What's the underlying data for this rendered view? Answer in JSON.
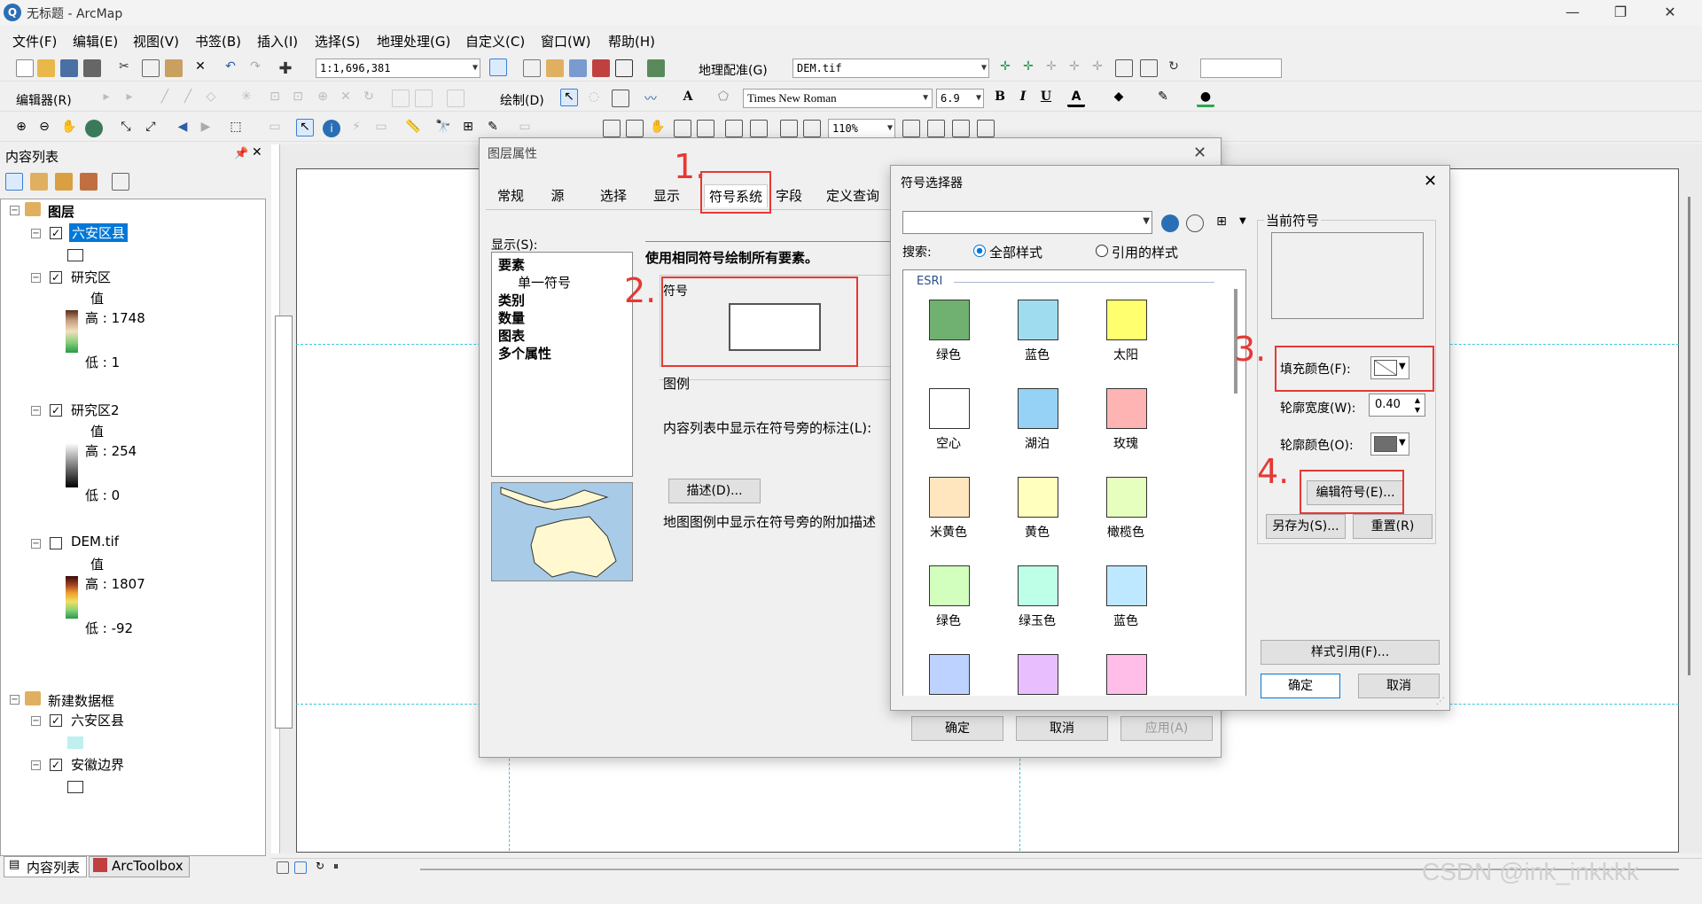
{
  "window": {
    "title": "无标题 - ArcMap",
    "icon": "arcmap-icon"
  },
  "menu": [
    "文件(F)",
    "编辑(E)",
    "视图(V)",
    "书签(B)",
    "插入(I)",
    "选择(S)",
    "地理处理(G)",
    "自定义(C)",
    "窗口(W)",
    "帮助(H)"
  ],
  "toolbar": {
    "scale": "1:1,696,381",
    "georef_label": "地理配准(G)",
    "georef_layer": "DEM.tif",
    "editor_label": "编辑器(R)",
    "draw_label": "绘制(D)",
    "font_name": "Times New Roman",
    "font_size": "6.9",
    "bold": "B",
    "italic": "I",
    "underline": "U",
    "zoom": "110%"
  },
  "toc": {
    "title": "内容列表",
    "root": "图层",
    "layers": [
      {
        "name": "六安区县",
        "checked": true,
        "selected": true
      },
      {
        "name": "研究区",
        "checked": true,
        "value_label": "值",
        "high": "高 : 1748",
        "low": "低 : 1"
      },
      {
        "name": "研究区2",
        "checked": true,
        "value_label": "值",
        "high": "高 : 254",
        "low": "低 : 0"
      },
      {
        "name": "DEM.tif",
        "checked": false,
        "value_label": "值",
        "high": "高 : 1807",
        "low": "低 : -92"
      }
    ],
    "frame2": "新建数据框",
    "frame2_layers": [
      {
        "name": "六安区县",
        "checked": true
      },
      {
        "name": "安徽边界",
        "checked": true
      }
    ],
    "bottom_tabs": [
      "内容列表",
      "ArcToolbox"
    ]
  },
  "layer_props": {
    "title": "图层属性",
    "tabs": [
      "常规",
      "源",
      "选择",
      "显示",
      "符号系统",
      "字段",
      "定义查询"
    ],
    "show_label": "显示(S):",
    "show_items": [
      "要素",
      "单一符号",
      "类别",
      "数量",
      "图表",
      "多个属性"
    ],
    "heading": "使用相同符号绘制所有要素。",
    "symbol_group": "符号",
    "legend_group": "图例",
    "legend_text": "内容列表中显示在符号旁的标注(L):",
    "describe_btn": "描述(D)...",
    "desc_text": "地图图例中显示在符号旁的附加描述",
    "ok": "确定",
    "cancel": "取消",
    "apply": "应用(A)"
  },
  "symbol_selector": {
    "title": "符号选择器",
    "search_label": "搜索:",
    "radio_all": "全部样式",
    "radio_ref": "引用的样式",
    "group": "ESRI",
    "symbols": [
      {
        "label": "绿色",
        "color": "#70b070"
      },
      {
        "label": "蓝色",
        "color": "#a0dcf0"
      },
      {
        "label": "太阳",
        "color": "#ffff70"
      },
      {
        "label": "空心",
        "color": "#ffffff"
      },
      {
        "label": "湖泊",
        "color": "#96d2f5"
      },
      {
        "label": "玫瑰",
        "color": "#ffb4b4"
      },
      {
        "label": "米黄色",
        "color": "#ffe6be"
      },
      {
        "label": "黄色",
        "color": "#ffffbe"
      },
      {
        "label": "橄榄色",
        "color": "#e6ffbe"
      },
      {
        "label": "绿色",
        "color": "#d2ffbe"
      },
      {
        "label": "绿玉色",
        "color": "#beffe8"
      },
      {
        "label": "蓝色",
        "color": "#bee8ff"
      },
      {
        "label": "",
        "color": "#bed2ff"
      },
      {
        "label": "",
        "color": "#e8beff"
      },
      {
        "label": "",
        "color": "#ffbee8"
      }
    ],
    "current_symbol": "当前符号",
    "fill_color_label": "填充颜色(F):",
    "outline_width_label": "轮廓宽度(W):",
    "outline_width": "0.40",
    "outline_color_label": "轮廓颜色(O):",
    "edit_symbol": "编辑符号(E)...",
    "save_as": "另存为(S)...",
    "reset": "重置(R)",
    "style_ref": "样式引用(F)...",
    "ok": "确定",
    "cancel": "取消"
  },
  "annotations": [
    "1.",
    "2.",
    "3.",
    "4."
  ],
  "watermark": "CSDN @ink_inkkkk",
  "colors": {
    "annotation": "#e53935",
    "selected": "#0078d7"
  }
}
